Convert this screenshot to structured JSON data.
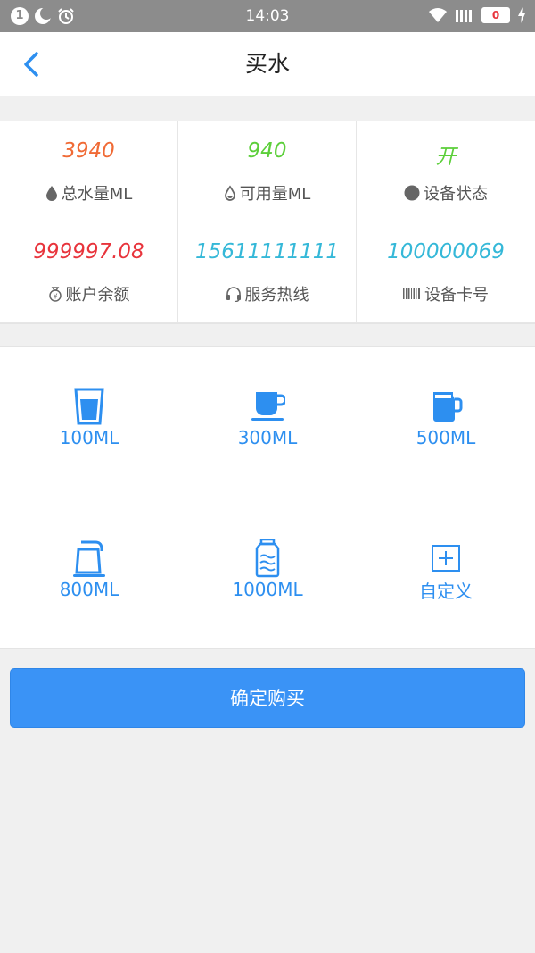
{
  "status_bar": {
    "time": "14:03",
    "notification_count": "1",
    "battery_level": "0"
  },
  "nav": {
    "title": "买水"
  },
  "stats": [
    {
      "value": "3940",
      "label": "总水量ML",
      "color": "#f06a35",
      "icon": "water-drop-icon"
    },
    {
      "value": "940",
      "label": "可用量ML",
      "color": "#5ccf3a",
      "icon": "water-drop-outline-icon"
    },
    {
      "value": "开",
      "label": "设备状态",
      "color": "#5ccf3a",
      "icon": "status-dot-icon"
    },
    {
      "value": "999997.08",
      "label": "账户余额",
      "color": "#e8343c",
      "icon": "money-bag-icon"
    },
    {
      "value": "15611111111",
      "label": "服务热线",
      "color": "#35b8d8",
      "icon": "headset-icon"
    },
    {
      "value": "100000069",
      "label": "设备卡号",
      "color": "#35b8d8",
      "icon": "barcode-icon"
    }
  ],
  "options": [
    {
      "label": "100ML",
      "icon": "glass-icon"
    },
    {
      "label": "300ML",
      "icon": "cup-icon"
    },
    {
      "label": "500ML",
      "icon": "pitcher-icon"
    },
    {
      "label": "800ML",
      "icon": "kettle-icon"
    },
    {
      "label": "1000ML",
      "icon": "water-jug-icon"
    },
    {
      "label": "自定义",
      "icon": "plus-box-icon"
    }
  ],
  "buy_button": {
    "label": "确定购买"
  },
  "colors": {
    "accent": "#3a93f6",
    "option_text": "#2d8ff0"
  }
}
